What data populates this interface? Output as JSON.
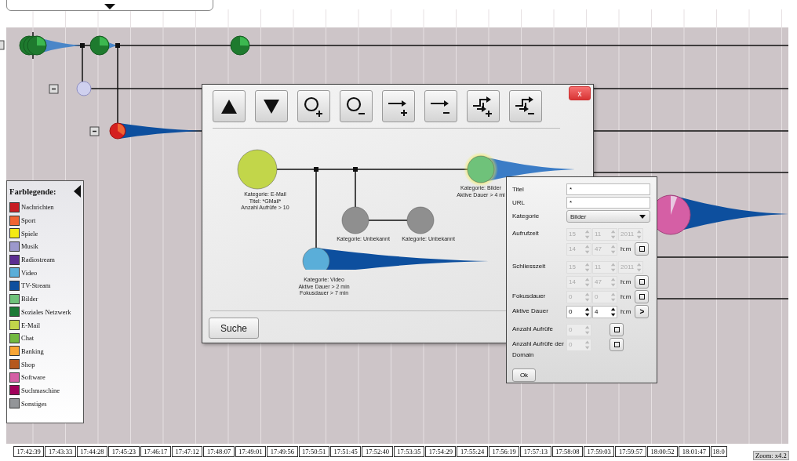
{
  "legend": {
    "title": "Farblegende:",
    "items": [
      {
        "label": "Nachrichten",
        "color": "#c81e24"
      },
      {
        "label": "Sport",
        "color": "#f06433"
      },
      {
        "label": "Spiele",
        "color": "#f5ea14"
      },
      {
        "label": "Musik",
        "color": "#9c98cc"
      },
      {
        "label": "Radiostream",
        "color": "#5b2d91"
      },
      {
        "label": "Video",
        "color": "#5aaed9"
      },
      {
        "label": "TV-Stream",
        "color": "#0d4f9e"
      },
      {
        "label": "Bilder",
        "color": "#6fc27a"
      },
      {
        "label": "Soziales Netzwerk",
        "color": "#1b7a35"
      },
      {
        "label": "E-Mail",
        "color": "#c2d64a"
      },
      {
        "label": "Chat",
        "color": "#72b93f"
      },
      {
        "label": "Banking",
        "color": "#f9a533"
      },
      {
        "label": "Shop",
        "color": "#b5581d"
      },
      {
        "label": "Software",
        "color": "#d55fa5"
      },
      {
        "label": "Suchmaschine",
        "color": "#a0005a"
      },
      {
        "label": "Sonstiges",
        "color": "#939598"
      }
    ]
  },
  "query_dialog": {
    "close_label": "x",
    "toolbar": [
      {
        "kind": "up"
      },
      {
        "kind": "down"
      },
      {
        "kind": "add-node"
      },
      {
        "kind": "remove-node"
      },
      {
        "kind": "add-edge"
      },
      {
        "kind": "remove-edge"
      },
      {
        "kind": "add-branch"
      },
      {
        "kind": "remove-branch"
      }
    ],
    "nodes": [
      {
        "lines": [
          "Kategorie: E-Mail",
          "Titel: *GMail*",
          "Anzahl Aufrüfe > 10"
        ],
        "color": "#c2d64a",
        "tail": false,
        "selected": false
      },
      {
        "lines": [
          "Kategorie: Bilder",
          "Aktive Dauer > 4 mi"
        ],
        "color": "#6fc27a",
        "tail": true,
        "selected": true
      },
      {
        "lines": [
          "Kategorie: Unbekannt"
        ],
        "color": "#8f8f8f",
        "tail": false,
        "selected": false
      },
      {
        "lines": [
          "Kategorie: Unbekannt"
        ],
        "color": "#8f8f8f",
        "tail": false,
        "selected": false
      },
      {
        "lines": [
          "Kategorie: Video",
          "Aktive Dauer > 2 min",
          "Fokusdauer > 7 min"
        ],
        "color": "#5aaed9",
        "tail": true,
        "selected": false
      }
    ],
    "search_button": "Suche"
  },
  "filter_panel": {
    "rows": [
      {
        "kind": "text",
        "label": "Titel",
        "value": "*"
      },
      {
        "kind": "text",
        "label": "URL",
        "value": "*"
      },
      {
        "kind": "select",
        "label": "Kategorie",
        "value": "Bilder"
      },
      {
        "kind": "datetime",
        "label": "Aufrufzeit",
        "disabled": true,
        "date": [
          "15",
          "11",
          "2011"
        ],
        "time": [
          "14",
          "47"
        ],
        "unit": "h:m"
      },
      {
        "kind": "datetime",
        "label": "Schliesszeit",
        "disabled": true,
        "date": [
          "15",
          "11",
          "2011"
        ],
        "time": [
          "14",
          "47"
        ],
        "unit": "h:m"
      },
      {
        "kind": "duration",
        "label": "Fokusdauer",
        "disabled": true,
        "time": [
          "0",
          "0"
        ],
        "unit": "h:m"
      },
      {
        "kind": "duration",
        "label": "Aktive Dauer",
        "disabled": false,
        "time": [
          "0",
          "4"
        ],
        "unit": "h:m",
        "operator": ">"
      },
      {
        "kind": "count",
        "label": "Anzahl Aufrüfe",
        "disabled": true,
        "value": "0"
      },
      {
        "kind": "count",
        "label": "Anzahl Aufrüfe der Domain",
        "disabled": true,
        "value": "0"
      }
    ],
    "ok_button": "Ok"
  },
  "timeline": {
    "ticks": [
      "17:42:39",
      "17:43:33",
      "17:44:28",
      "17:45:23",
      "17:46:17",
      "17:47:12",
      "17:48:07",
      "17:49:01",
      "17:49:56",
      "17:50:51",
      "17:51:45",
      "17:52:40",
      "17:53:35",
      "17:54:29",
      "17:55:24",
      "17:56:19",
      "17:57:13",
      "17:58:08",
      "17:59:03",
      "17:59:57",
      "18:00:52",
      "18:01:47",
      "18:0"
    ],
    "zoom": "Zoom: x4.2"
  }
}
